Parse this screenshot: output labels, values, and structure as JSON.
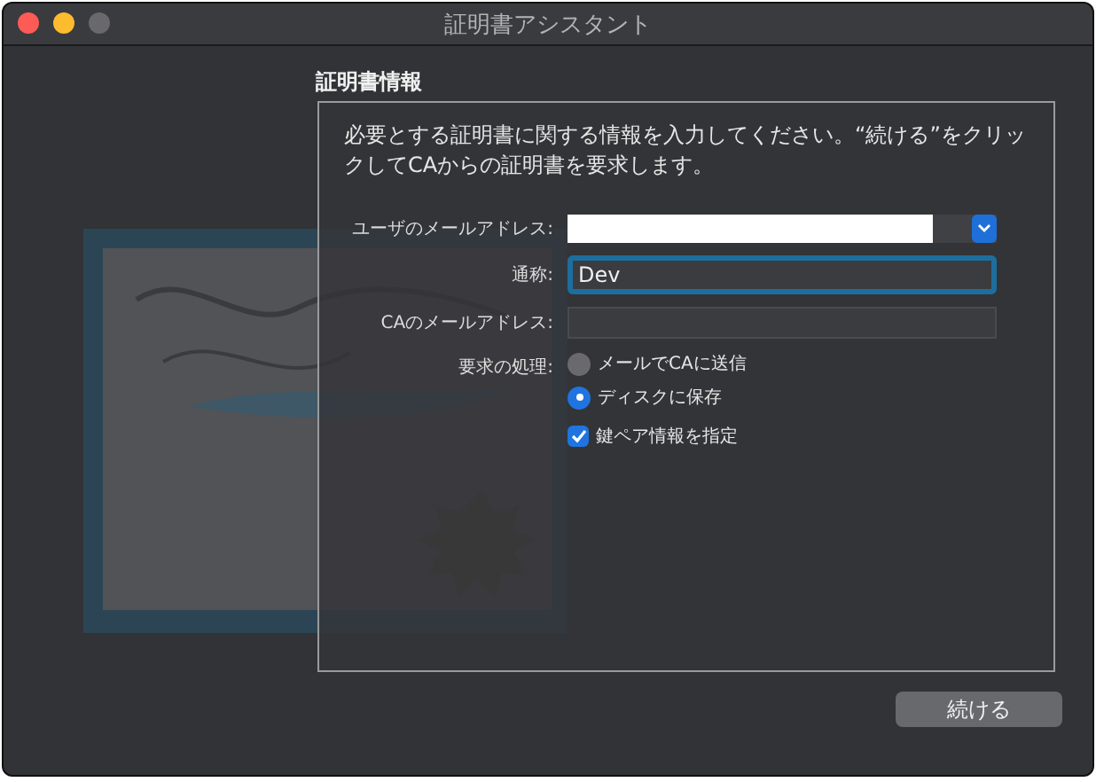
{
  "window": {
    "title": "証明書アシスタント"
  },
  "section_title": "証明書情報",
  "instructions": "必要とする証明書に関する情報を入力してください。“続ける”をクリックしてCAからの証明書を要求します。",
  "fields": [
    {
      "label": "ユーザのメールアドレス:",
      "kind": "combo",
      "focused": false
    },
    {
      "label": "通称:",
      "kind": "text",
      "value": "Dev",
      "focused": true
    },
    {
      "label": "CAのメールアドレス:",
      "kind": "text",
      "focused": false
    }
  ],
  "request": {
    "label": "要求の処理:",
    "options": [
      {
        "label": "メールでCAに送信",
        "selected": false
      },
      {
        "label": "ディスクに保存",
        "selected": true
      }
    ],
    "checkbox": {
      "label": "鍵ペア情報を指定",
      "checked": true
    }
  },
  "buttons": [
    "続ける"
  ]
}
